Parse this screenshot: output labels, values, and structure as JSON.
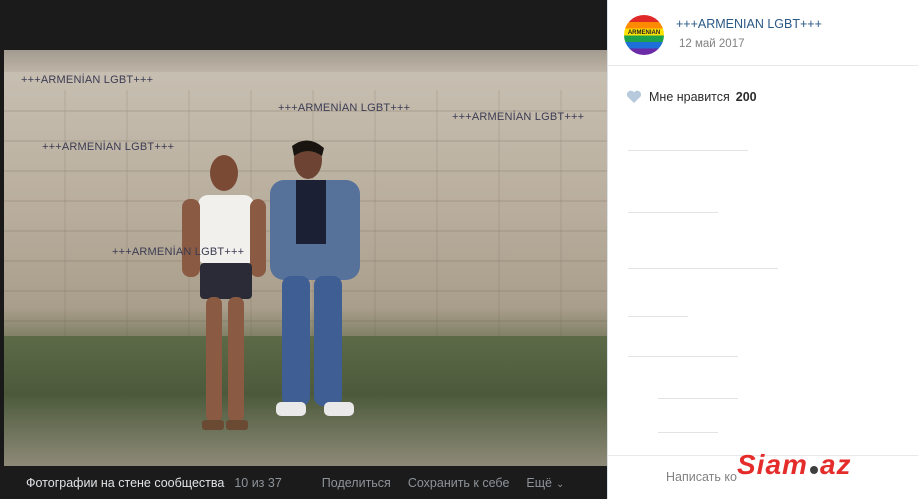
{
  "post": {
    "author_name": "+++ARMENIAN LGBT+++",
    "date": "12 май 2017",
    "avatar_text": "ARMENIAN"
  },
  "likes": {
    "label": "Мне нравится",
    "count": "200"
  },
  "photo": {
    "watermark_text": "+++ARMENİAN LGBT+++"
  },
  "footer": {
    "album_title": "Фотографии на стене сообщества",
    "counter": "10 из 37",
    "share_label": "Поделиться",
    "save_label": "Сохранить к себе",
    "more_label": "Ещё"
  },
  "comment": {
    "placeholder": "Написать ко"
  },
  "site_logo": {
    "text_left": "Siam",
    "text_right": "az"
  },
  "colors": {
    "link": "#2a5885",
    "logo_red": "#e42d2b",
    "viewer_bg": "#141414"
  }
}
